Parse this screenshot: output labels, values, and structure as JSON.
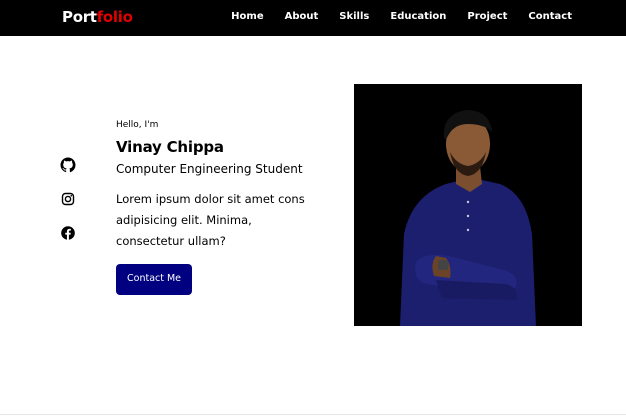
{
  "brand": {
    "logo_part1": "Port",
    "logo_part2": "folio"
  },
  "nav": {
    "items": [
      {
        "label": "Home"
      },
      {
        "label": "About"
      },
      {
        "label": "Skills"
      },
      {
        "label": "Education"
      },
      {
        "label": "Project"
      },
      {
        "label": "Contact"
      }
    ]
  },
  "social": {
    "icons": [
      "github-icon",
      "instagram-icon",
      "facebook-icon"
    ]
  },
  "hero": {
    "greeting": "Hello, I'm",
    "name": "Vinay Chippa",
    "role": "Computer Engineering Student",
    "description": "Lorem ipsum dolor sit amet cons adipisicing elit. Minima, consectetur ullam?",
    "cta_label": "Contact Me"
  },
  "colors": {
    "navbar_bg": "#000000",
    "logo_accent": "#e00000",
    "button_bg": "#000080"
  }
}
